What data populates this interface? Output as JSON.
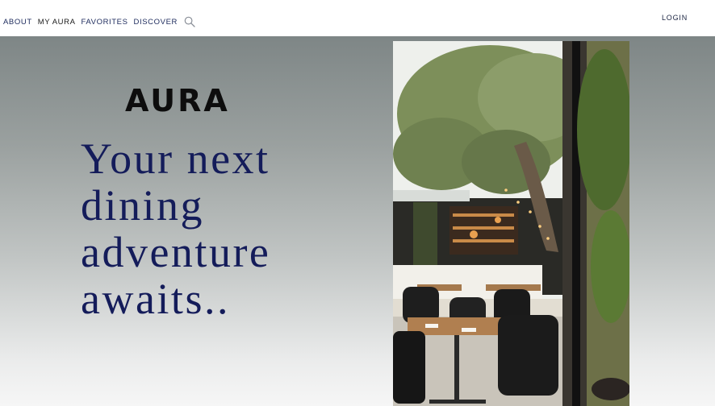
{
  "nav": {
    "items": [
      {
        "label": "ABOUT",
        "tone": "accent"
      },
      {
        "label": "MY AURA",
        "tone": "dark"
      },
      {
        "label": "FAVORITES",
        "tone": "accent"
      },
      {
        "label": "DISCOVER",
        "tone": "accent"
      }
    ],
    "search_icon": "search-icon",
    "login_label": "LOGIN"
  },
  "hero": {
    "brand": "AURA",
    "tagline": "Your next dining adventure awaits..",
    "photo_icon": "restaurant-photo"
  },
  "colors": {
    "nav_text": "#1c2a5c",
    "tagline": "#141c5a",
    "brand": "#0d0d0d",
    "hero_top": "#7e8686",
    "hero_bottom": "#f6f6f6"
  }
}
